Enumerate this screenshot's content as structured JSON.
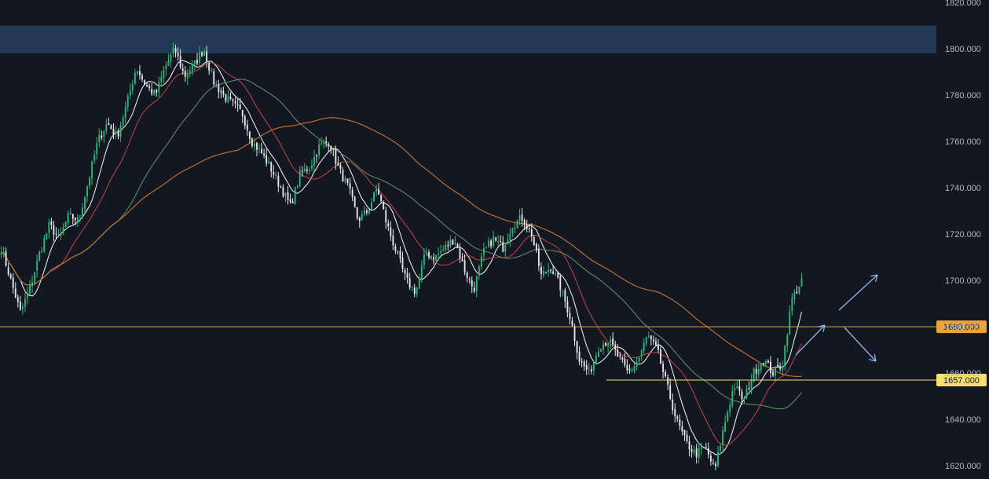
{
  "chart_data": {
    "type": "candlestick",
    "title": "",
    "xlabel": "",
    "ylabel": "",
    "ylim": [
      1616,
      1821
    ],
    "grid": false,
    "y_axis_ticks": [
      "1620.000",
      "1640.000",
      "1660.000",
      "1680.000",
      "1700.000",
      "1720.000",
      "1740.000",
      "1760.000",
      "1780.000",
      "1800.000",
      "1820.000"
    ],
    "resistance_zone": {
      "from": 1798,
      "to": 1810,
      "color": "#233957"
    },
    "horizontal_levels": [
      {
        "value": 1680,
        "label": "1680.000",
        "color": "#e8a33a"
      },
      {
        "value": 1657,
        "label": "1657.000",
        "color": "#f5e06b"
      }
    ],
    "projection_arrows": {
      "color": "#8fb6e6",
      "directions": [
        "up",
        "down"
      ]
    },
    "price_anchors": [
      1714,
      1700,
      1686,
      1697,
      1712,
      1724,
      1718,
      1728,
      1726,
      1742,
      1760,
      1768,
      1762,
      1776,
      1792,
      1784,
      1780,
      1792,
      1800,
      1788,
      1793,
      1800,
      1786,
      1780,
      1776,
      1772,
      1760,
      1755,
      1748,
      1740,
      1732,
      1746,
      1749,
      1758,
      1760,
      1748,
      1740,
      1726,
      1730,
      1740,
      1724,
      1712,
      1700,
      1695,
      1712,
      1710,
      1714,
      1718,
      1705,
      1696,
      1712,
      1718,
      1714,
      1724,
      1727,
      1720,
      1702,
      1706,
      1697,
      1684,
      1665,
      1660,
      1672,
      1674,
      1667,
      1660,
      1665,
      1676,
      1670,
      1655,
      1640,
      1630,
      1625,
      1628,
      1618,
      1638,
      1655,
      1648,
      1660,
      1666,
      1660,
      1664,
      1692,
      1700
    ],
    "moving_averages": [
      {
        "color": "#e8e8e8",
        "period": 9
      },
      {
        "color": "#b84040",
        "period": 21
      },
      {
        "color": "#5e8a64",
        "period": 50
      },
      {
        "color": "#c7762f",
        "period": 100
      }
    ],
    "colors": {
      "background": "#131722",
      "candle_up": "#2eb877",
      "candle_down": "#e6e6e6",
      "axis_text": "#b2b5be"
    }
  }
}
